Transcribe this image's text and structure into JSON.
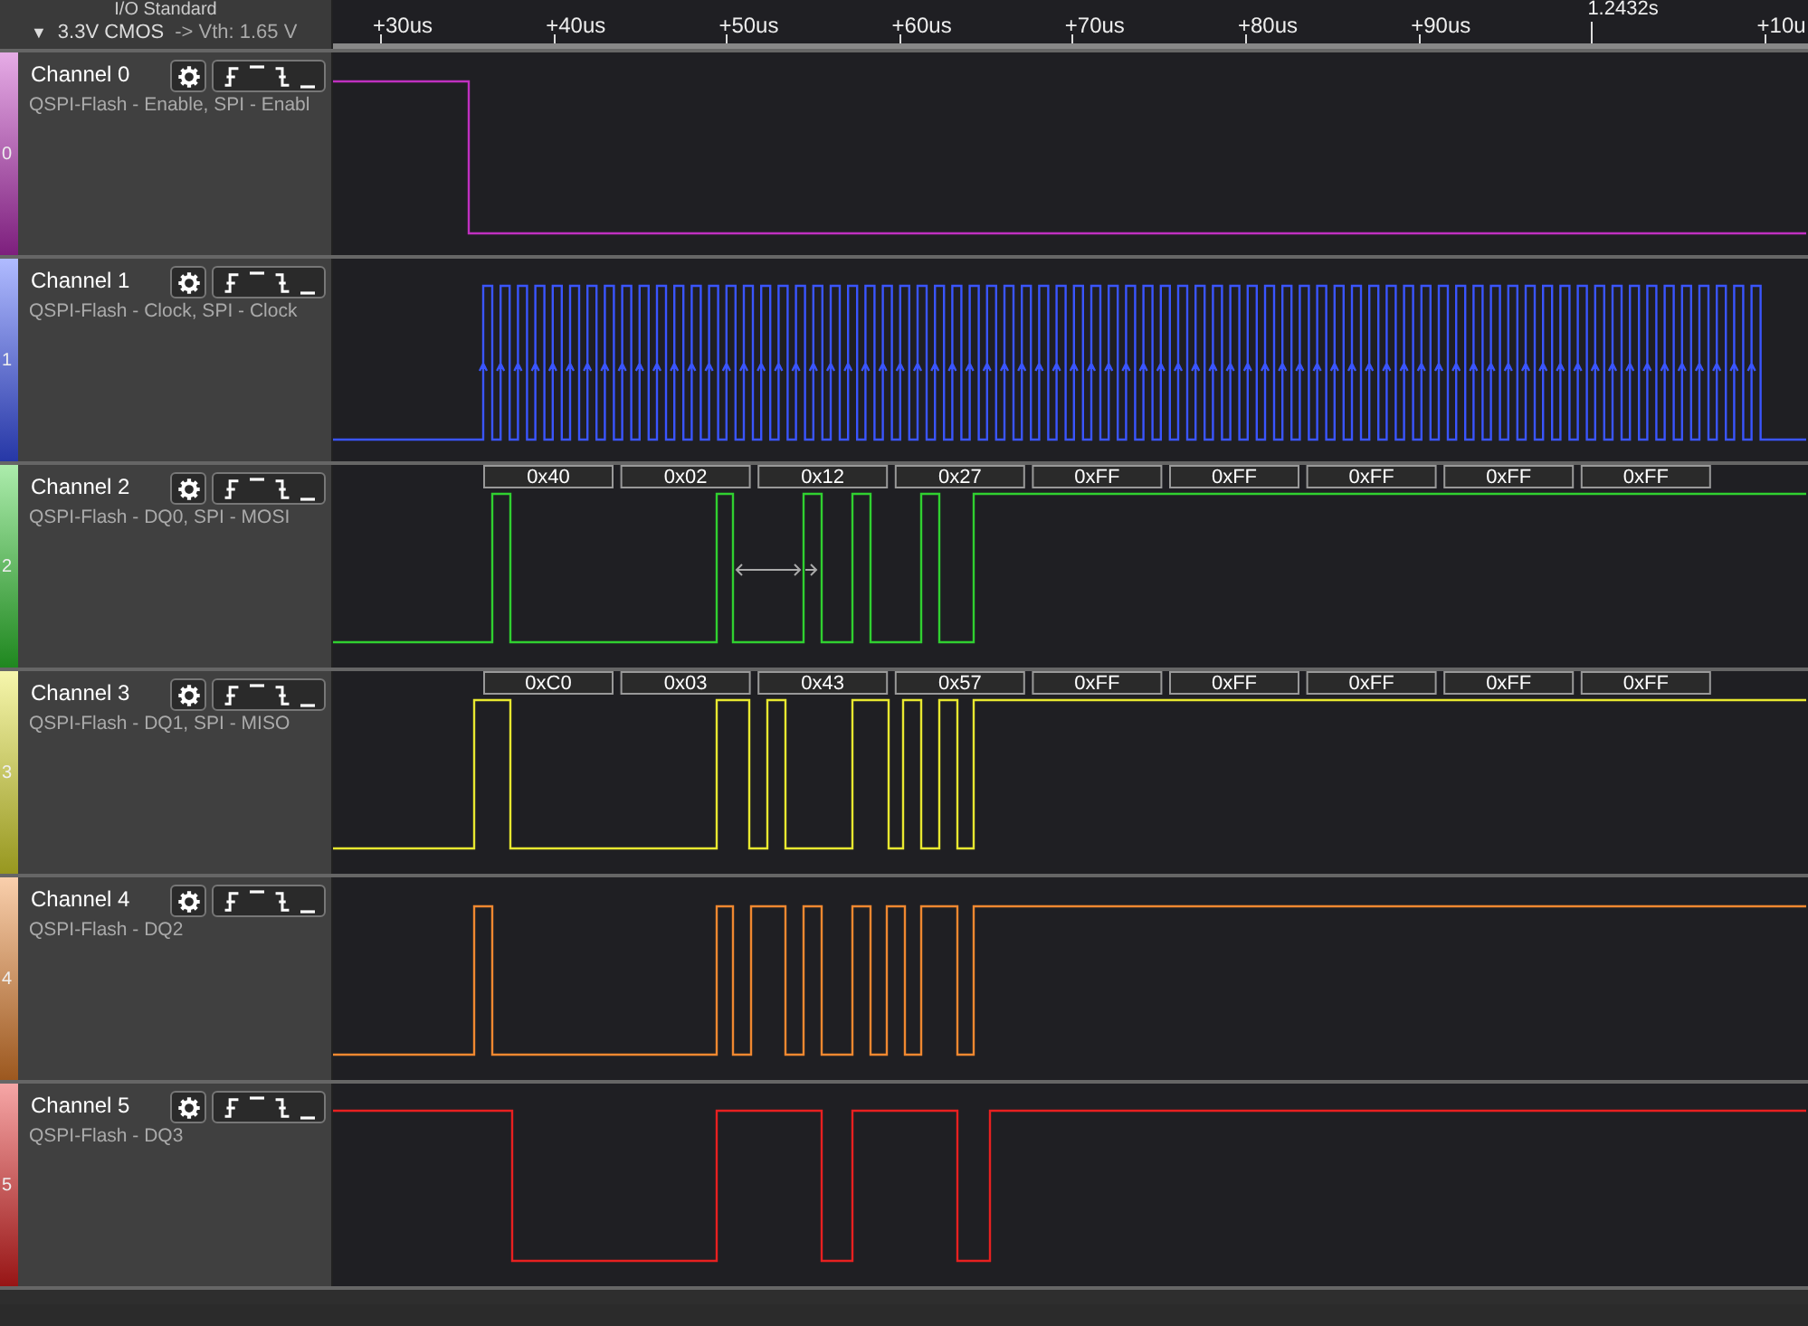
{
  "io_panel": {
    "title": "I/O Standard",
    "toggle": "▼",
    "standard": "3.3V CMOS",
    "threshold": "-> Vth: 1.65 V"
  },
  "ruler": {
    "ticks": [
      {
        "label": "+30us",
        "kind": "offset"
      },
      {
        "label": "+40us",
        "kind": "offset"
      },
      {
        "label": "+50us",
        "kind": "offset"
      },
      {
        "label": "+60us",
        "kind": "offset"
      },
      {
        "label": "+70us",
        "kind": "offset"
      },
      {
        "label": "+80us",
        "kind": "offset"
      },
      {
        "label": "+90us",
        "kind": "offset"
      },
      {
        "label": "1.2432s",
        "kind": "cursor"
      },
      {
        "label": "+10u",
        "kind": "offset"
      }
    ]
  },
  "channels": [
    {
      "number": "0",
      "name": "Channel 0",
      "description": "QSPI-Flash - Enable, SPI - Enabl",
      "color": "#c030c0"
    },
    {
      "number": "1",
      "name": "Channel 1",
      "description": "QSPI-Flash - Clock, SPI - Clock",
      "color": "#3a55ff"
    },
    {
      "number": "2",
      "name": "Channel 2",
      "description": "QSPI-Flash - DQ0, SPI - MOSI",
      "color": "#30d030",
      "decodes": [
        "0x40",
        "0x02",
        "0x12",
        "0x27",
        "0xFF",
        "0xFF",
        "0xFF",
        "0xFF",
        "0xFF"
      ]
    },
    {
      "number": "3",
      "name": "Channel 3",
      "description": "QSPI-Flash - DQ1, SPI - MISO",
      "color": "#e8e830",
      "decodes": [
        "0xC0",
        "0x03",
        "0x43",
        "0x57",
        "0xFF",
        "0xFF",
        "0xFF",
        "0xFF",
        "0xFF"
      ]
    },
    {
      "number": "4",
      "name": "Channel 4",
      "description": "QSPI-Flash - DQ2",
      "color": "#f08830"
    },
    {
      "number": "5",
      "name": "Channel 5",
      "description": "QSPI-Flash - DQ3",
      "color": "#e82020"
    }
  ]
}
